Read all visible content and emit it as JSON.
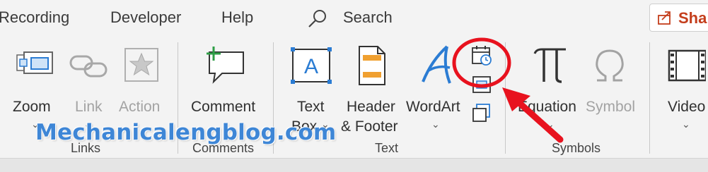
{
  "tabs": [
    {
      "label": "Recording"
    },
    {
      "label": "Developer"
    },
    {
      "label": "Help"
    }
  ],
  "search": {
    "label": "Search",
    "icon": "search-icon"
  },
  "share": {
    "label": "Sha",
    "icon": "share-icon",
    "color": "#c43e1c"
  },
  "groups": {
    "links": {
      "label": "Links",
      "buttons": {
        "zoom": "Zoom",
        "link": "Link",
        "action": "Action"
      }
    },
    "comments": {
      "label": "Comments",
      "buttons": {
        "comment": "Comment"
      }
    },
    "text": {
      "label": "Text",
      "buttons": {
        "text_box_line1": "Text",
        "text_box_line2": "Box",
        "header_line1": "Header",
        "header_line2": "& Footer",
        "wordart": "WordArt"
      },
      "small_buttons": [
        "date-time-icon",
        "slide-number-icon",
        "object-icon"
      ]
    },
    "symbols": {
      "label": "Symbols",
      "buttons": {
        "equation": "Equation",
        "symbol": "Symbol"
      }
    },
    "media": {
      "buttons": {
        "video": "Video"
      }
    }
  },
  "watermark": "Mechanicalengblog.com",
  "annotation": {
    "color": "#e8121e"
  },
  "colors": {
    "accent_blue": "#2b7cd3",
    "orange": "#f0a030",
    "green": "#2e9e46"
  }
}
